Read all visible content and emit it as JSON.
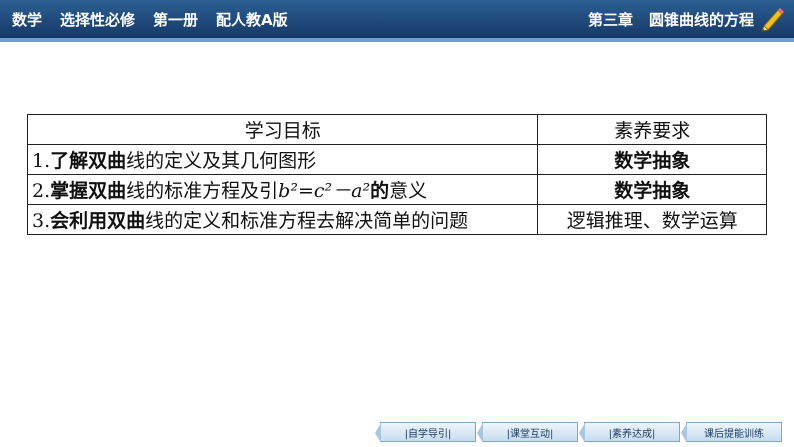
{
  "header": {
    "items": [
      "数学",
      "选择性必修",
      "第一册",
      "配人教A版"
    ],
    "chapter": "第三章",
    "chapter_title": "圆锥曲线的方程",
    "icon": "pencil-icon",
    "colors": {
      "bar": "#1c4474",
      "line": "#6f9fcc"
    }
  },
  "table": {
    "headers": [
      "学习目标",
      "素养要求"
    ],
    "rows": [
      {
        "num": "1.",
        "bold1": "了解双曲",
        "rest": "线的定义及其几何图形",
        "competency": "数学抽象"
      },
      {
        "num": "2.",
        "bold1": "掌握双曲",
        "rest": "线的标准方程及引",
        "formula": "b²=c²－a²",
        "bold2": "的",
        "rest2": "意义",
        "competency": "数学抽象"
      },
      {
        "num": "3.",
        "bold1": "会利用双曲",
        "rest": "线的定义和标准方程去解决简单的问题",
        "competency": "逻辑推理、数学运算"
      }
    ]
  },
  "nav": {
    "buttons": [
      "|自学导引|",
      "|课堂互动|",
      "|素养达成|",
      "课后提能训练"
    ]
  }
}
